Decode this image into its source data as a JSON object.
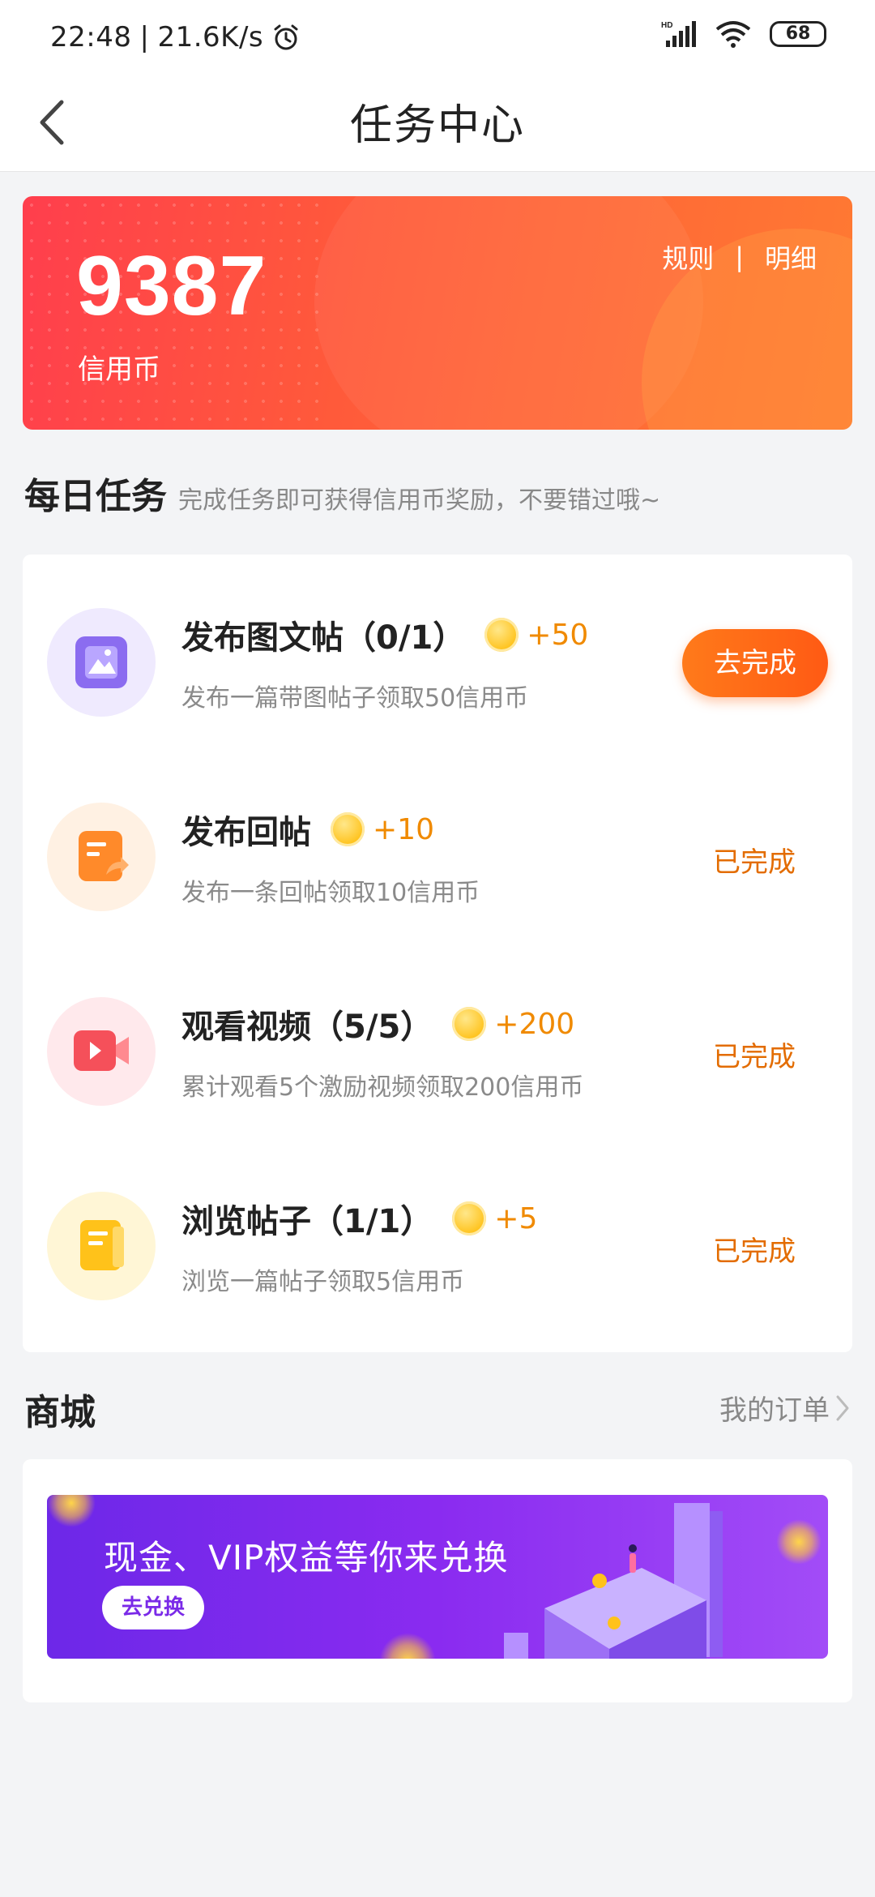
{
  "status_bar": {
    "time": "22:48",
    "network_speed": "21.6K/s",
    "alarm_icon": "alarm-icon",
    "signal_label": "HD",
    "battery": "68"
  },
  "header": {
    "title": "任务中心",
    "back_icon": "chevron-left-icon"
  },
  "credits": {
    "amount": "9387",
    "unit": "信用币",
    "rules_label": "规则",
    "separator": "|",
    "details_label": "明细"
  },
  "daily": {
    "title": "每日任务",
    "subtitle": "完成任务即可获得信用币奖励，不要错过哦~"
  },
  "tasks": [
    {
      "title": "发布图文帖（0/1）",
      "reward": "+50",
      "desc": "发布一篇带图帖子领取50信用币",
      "action": "去完成",
      "status": "pending",
      "icon": "image-post-icon",
      "color": "#8b6cf0"
    },
    {
      "title": "发布回帖",
      "reward": "+10",
      "desc": "发布一条回帖领取10信用币",
      "action": "已完成",
      "status": "done",
      "icon": "reply-post-icon",
      "color": "#ff8a2a"
    },
    {
      "title": "观看视频（5/5）",
      "reward": "+200",
      "desc": "累计观看5个激励视频领取200信用币",
      "action": "已完成",
      "status": "done",
      "icon": "video-icon",
      "color": "#f5505a"
    },
    {
      "title": "浏览帖子（1/1）",
      "reward": "+5",
      "desc": "浏览一篇帖子领取5信用币",
      "action": "已完成",
      "status": "done",
      "icon": "browse-post-icon",
      "color": "#ffc21a"
    }
  ],
  "mall": {
    "title": "商城",
    "my_orders": "我的订单",
    "banner_text": "现金、VIP权益等你来兑换",
    "banner_button": "去兑换"
  },
  "colors": {
    "accent_orange": "#ff6a1a",
    "done_text": "#e36c00",
    "banner_red": "#ff3e4d",
    "mall_purple": "#8a2bf0"
  }
}
